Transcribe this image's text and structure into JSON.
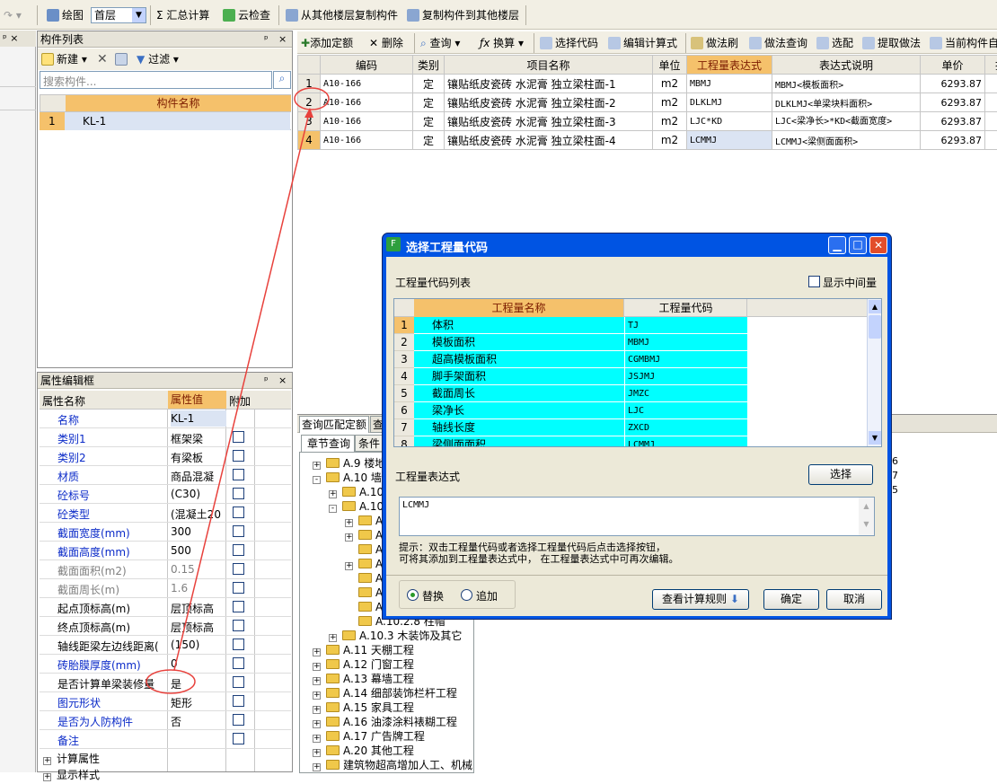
{
  "toolbar": {
    "draw": "绘图",
    "floor": "首层",
    "sum_calc": "汇总计算",
    "cloud_check": "云检查",
    "copy_from": "从其他楼层复制构件",
    "copy_to": "复制构件到其他楼层"
  },
  "component_list": {
    "title": "构件列表",
    "new_btn": "新建",
    "filter_btn": "过滤",
    "search_placeholder": "搜索构件...",
    "col_header": "构件名称",
    "rows": [
      {
        "num": "1",
        "name": "KL-1"
      }
    ]
  },
  "prop_editor": {
    "title": "属性编辑框",
    "col_name": "属性名称",
    "col_value": "属性值",
    "col_add": "附加",
    "rows": [
      {
        "name": "名称",
        "value": "KL-1",
        "blue": true
      },
      {
        "name": "类别1",
        "value": "框架梁",
        "blue": true
      },
      {
        "name": "类别2",
        "value": "有梁板",
        "blue": true
      },
      {
        "name": "材质",
        "value": "商品混凝",
        "blue": true
      },
      {
        "name": "砼标号",
        "value": "(C30)",
        "blue": true
      },
      {
        "name": "砼类型",
        "value": "(混凝土20",
        "blue": true
      },
      {
        "name": "截面宽度(mm)",
        "value": "300",
        "blue": true
      },
      {
        "name": "截面高度(mm)",
        "value": "500",
        "blue": true
      },
      {
        "name": "截面面积(m2)",
        "value": "0.15",
        "blue": false,
        "gray": true
      },
      {
        "name": "截面周长(m)",
        "value": "1.6",
        "blue": false,
        "gray": true
      },
      {
        "name": "起点顶标高(m)",
        "value": "层顶标高",
        "blue": false
      },
      {
        "name": "终点顶标高(m)",
        "value": "层顶标高",
        "blue": false
      },
      {
        "name": "轴线距梁左边线距离(",
        "value": "(150)",
        "blue": false
      },
      {
        "name": "砖胎膜厚度(mm)",
        "value": "0",
        "blue": true
      },
      {
        "name": "是否计算单梁装修量",
        "value": "是",
        "blue": false
      },
      {
        "name": "图元形状",
        "value": "矩形",
        "blue": true
      },
      {
        "name": "是否为人防构件",
        "value": "否",
        "blue": true
      },
      {
        "name": "备注",
        "value": "",
        "blue": true
      }
    ],
    "group1": "计算属性",
    "group2": "显示样式"
  },
  "main_toolbar": {
    "add_quota": "添加定额",
    "delete": "删除",
    "query": "查询",
    "convert": "换算",
    "select_code": "选择代码",
    "edit_formula": "编辑计算式",
    "method_brush": "做法刷",
    "method_query": "做法查询",
    "select_match": "选配",
    "extract_method": "提取做法",
    "current_comp": "当前构件自"
  },
  "quota_table": {
    "headers": [
      "编码",
      "类别",
      "项目名称",
      "单位",
      "工程量表达式",
      "表达式说明",
      "单价",
      "措"
    ],
    "rows": [
      {
        "num": "1",
        "code": "A10-166",
        "type": "定",
        "name": "镶贴纸皮瓷砖 水泥膏 独立梁柱面-1",
        "unit": "m2",
        "expr": "MBMJ",
        "desc": "MBMJ<模板面积>",
        "price": "6293.87"
      },
      {
        "num": "2",
        "code": "A10-166",
        "type": "定",
        "name": "镶贴纸皮瓷砖 水泥膏 独立梁柱面-2",
        "unit": "m2",
        "expr": "DLKLMJ",
        "desc": "DLKLMJ<单梁块料面积>",
        "price": "6293.87"
      },
      {
        "num": "3",
        "code": "A10-166",
        "type": "定",
        "name": "镶贴纸皮瓷砖 水泥膏 独立梁柱面-3",
        "unit": "m2",
        "expr": "LJC*KD",
        "desc": "LJC<梁净长>*KD<截面宽度>",
        "price": "6293.87"
      },
      {
        "num": "4",
        "code": "A10-166",
        "type": "定",
        "name": "镶贴纸皮瓷砖 水泥膏 独立梁柱面-4",
        "unit": "m2",
        "expr": "LCMMJ",
        "desc": "LCMMJ<梁侧面面积>",
        "price": "6293.87"
      }
    ]
  },
  "lower_panel": {
    "tab1": "查询匹配定额",
    "tab2": "查",
    "subtab1": "章节查询",
    "subtab2": "条件",
    "tree": [
      {
        "label": "A.9 楼地",
        "level": 0,
        "expand": "+"
      },
      {
        "label": "A.10 墙柱",
        "level": 0,
        "expand": "-"
      },
      {
        "label": "A.10",
        "level": 1,
        "expand": "+"
      },
      {
        "label": "A.10",
        "level": 1,
        "expand": "-"
      },
      {
        "label": "A",
        "level": 2,
        "expand": "+"
      },
      {
        "label": "A",
        "level": 2,
        "expand": "+"
      },
      {
        "label": "A",
        "level": 2,
        "expand": ""
      },
      {
        "label": "A",
        "level": 2,
        "expand": "+"
      },
      {
        "label": "A",
        "level": 2,
        "expand": ""
      },
      {
        "label": "A",
        "level": 2,
        "expand": ""
      },
      {
        "label": "A",
        "level": 2,
        "expand": ""
      },
      {
        "label": "A.10.2.8 柱帽",
        "level": 2,
        "expand": ""
      },
      {
        "label": "A.10.3 木装饰及其它",
        "level": 1,
        "expand": "+"
      },
      {
        "label": "A.11 天棚工程",
        "level": 0,
        "expand": "+"
      },
      {
        "label": "A.12 门窗工程",
        "level": 0,
        "expand": "+"
      },
      {
        "label": "A.13 幕墙工程",
        "level": 0,
        "expand": "+"
      },
      {
        "label": "A.14 细部装饰栏杆工程",
        "level": 0,
        "expand": "+"
      },
      {
        "label": "A.15 家具工程",
        "level": 0,
        "expand": "+"
      },
      {
        "label": "A.16 油漆涂料裱糊工程",
        "level": 0,
        "expand": "+"
      },
      {
        "label": "A.17 广告牌工程",
        "level": 0,
        "expand": "+"
      },
      {
        "label": "A.20 其他工程",
        "level": 0,
        "expand": "+"
      },
      {
        "label": "建筑物超高增加人工、机械",
        "level": 0,
        "expand": "+"
      }
    ],
    "right_digits": [
      "6",
      "7",
      "5"
    ]
  },
  "dialog": {
    "title": "选择工程量代码",
    "list_label": "工程量代码列表",
    "show_mid": "显示中间量",
    "col_name": "工程量名称",
    "col_code": "工程量代码",
    "rows": [
      {
        "num": "1",
        "name": "体积",
        "code": "TJ"
      },
      {
        "num": "2",
        "name": "模板面积",
        "code": "MBMJ"
      },
      {
        "num": "3",
        "name": "超高模板面积",
        "code": "CGMBMJ"
      },
      {
        "num": "4",
        "name": "脚手架面积",
        "code": "JSJMJ"
      },
      {
        "num": "5",
        "name": "截面周长",
        "code": "JMZC"
      },
      {
        "num": "6",
        "name": "梁净长",
        "code": "LJC"
      },
      {
        "num": "7",
        "name": "轴线长度",
        "code": "ZXCD"
      },
      {
        "num": "8",
        "name": "梁侧面面积",
        "code": "LCMMJ"
      }
    ],
    "expr_label": "工程量表达式",
    "select_btn": "选择",
    "expr_value": "LCMMJ",
    "hint1": "提示：双击工程量代码或者选择工程量代码后点击选择按钮，",
    "hint2": "可将其添加到工程量表达式中， 在工程量表达式中可再次编辑。",
    "radio_replace": "替换",
    "radio_append": "追加",
    "rule_btn": "查看计算规则",
    "ok_btn": "确定",
    "cancel_btn": "取消"
  },
  "colors": {
    "accent": "#f5c16b",
    "cyan": "#00ffff",
    "annotation": "#e8413c"
  }
}
